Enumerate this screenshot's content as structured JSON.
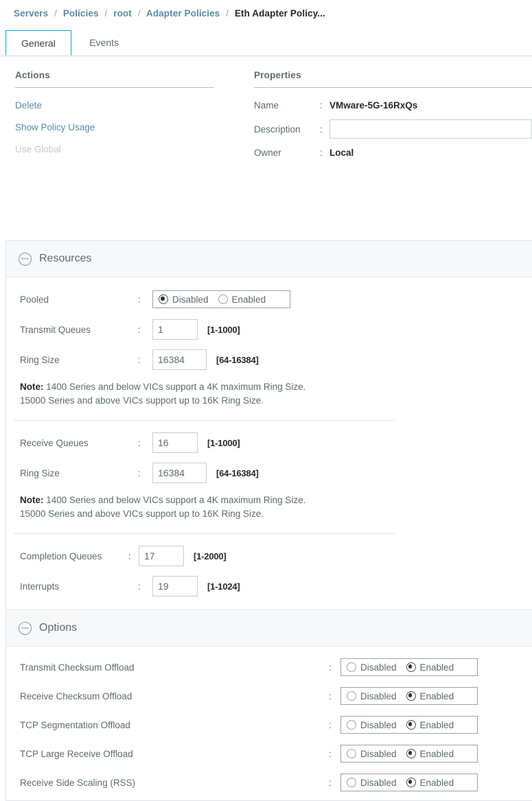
{
  "breadcrumb": {
    "items": [
      {
        "label": "Servers",
        "last": false
      },
      {
        "label": "Policies",
        "last": false
      },
      {
        "label": "root",
        "last": false
      },
      {
        "label": "Adapter Policies",
        "last": false
      },
      {
        "label": "Eth Adapter Policy...",
        "last": true
      }
    ],
    "separator": "/"
  },
  "tabs": [
    {
      "label": "General",
      "active": true
    },
    {
      "label": "Events",
      "active": false
    }
  ],
  "actions": {
    "heading": "Actions",
    "items": [
      {
        "label": "Delete",
        "disabled": false
      },
      {
        "label": "Show Policy Usage",
        "disabled": false
      },
      {
        "label": "Use Global",
        "disabled": true
      }
    ]
  },
  "properties": {
    "heading": "Properties",
    "colon": ":",
    "name_label": "Name",
    "name_value": "VMware-5G-16RxQs",
    "description_label": "Description",
    "description_value": "",
    "description_placeholder": "",
    "owner_label": "Owner",
    "owner_value": "Local"
  },
  "resources": {
    "title": "Resources",
    "collapse_icon": "minus-circle-icon",
    "pooled": {
      "label": "Pooled",
      "colon": ":",
      "options": [
        "Disabled",
        "Enabled"
      ],
      "selected": "Disabled"
    },
    "transmit": {
      "queues_label": "Transmit Queues",
      "queues_value": "1",
      "queues_hint": "[1-1000]",
      "ring_label": "Ring Size",
      "ring_value": "16384",
      "ring_hint": "[64-16384]",
      "note_prefix": "Note:",
      "note_line1": " 1400 Series and below VICs support a 4K maximum Ring Size.",
      "note_line2": "15000 Series and above VICs support up to 16K Ring Size."
    },
    "receive": {
      "queues_label": "Receive Queues",
      "queues_value": "16",
      "queues_hint": "[1-1000]",
      "ring_label": "Ring Size",
      "ring_value": "16384",
      "ring_hint": "[64-16384]",
      "note_prefix": "Note:",
      "note_line1": " 1400 Series and below VICs support a 4K maximum Ring Size.",
      "note_line2": "15000 Series and above VICs support up to 16K Ring Size."
    },
    "completion": {
      "label": "Completion Queues",
      "value": "17",
      "hint": "[1-2000]"
    },
    "interrupts": {
      "label": "Interrupts",
      "value": "19",
      "hint": "[1-1024]"
    },
    "colon": ":"
  },
  "options": {
    "title": "Options",
    "collapse_icon": "minus-circle-icon",
    "colon": ":",
    "choices": [
      "Disabled",
      "Enabled"
    ],
    "rows": [
      {
        "label": "Transmit Checksum Offload",
        "selected": "Enabled"
      },
      {
        "label": "Receive Checksum Offload",
        "selected": "Enabled"
      },
      {
        "label": "TCP Segmentation Offload",
        "selected": "Enabled"
      },
      {
        "label": "TCP Large Receive Offload",
        "selected": "Enabled"
      },
      {
        "label": "Receive Side Scaling (RSS)",
        "selected": "Enabled"
      }
    ]
  },
  "colors": {
    "link": "#5a8aa6",
    "tab_active_border": "#00a3d7",
    "panel_header_bg": "#f7f8f9"
  }
}
